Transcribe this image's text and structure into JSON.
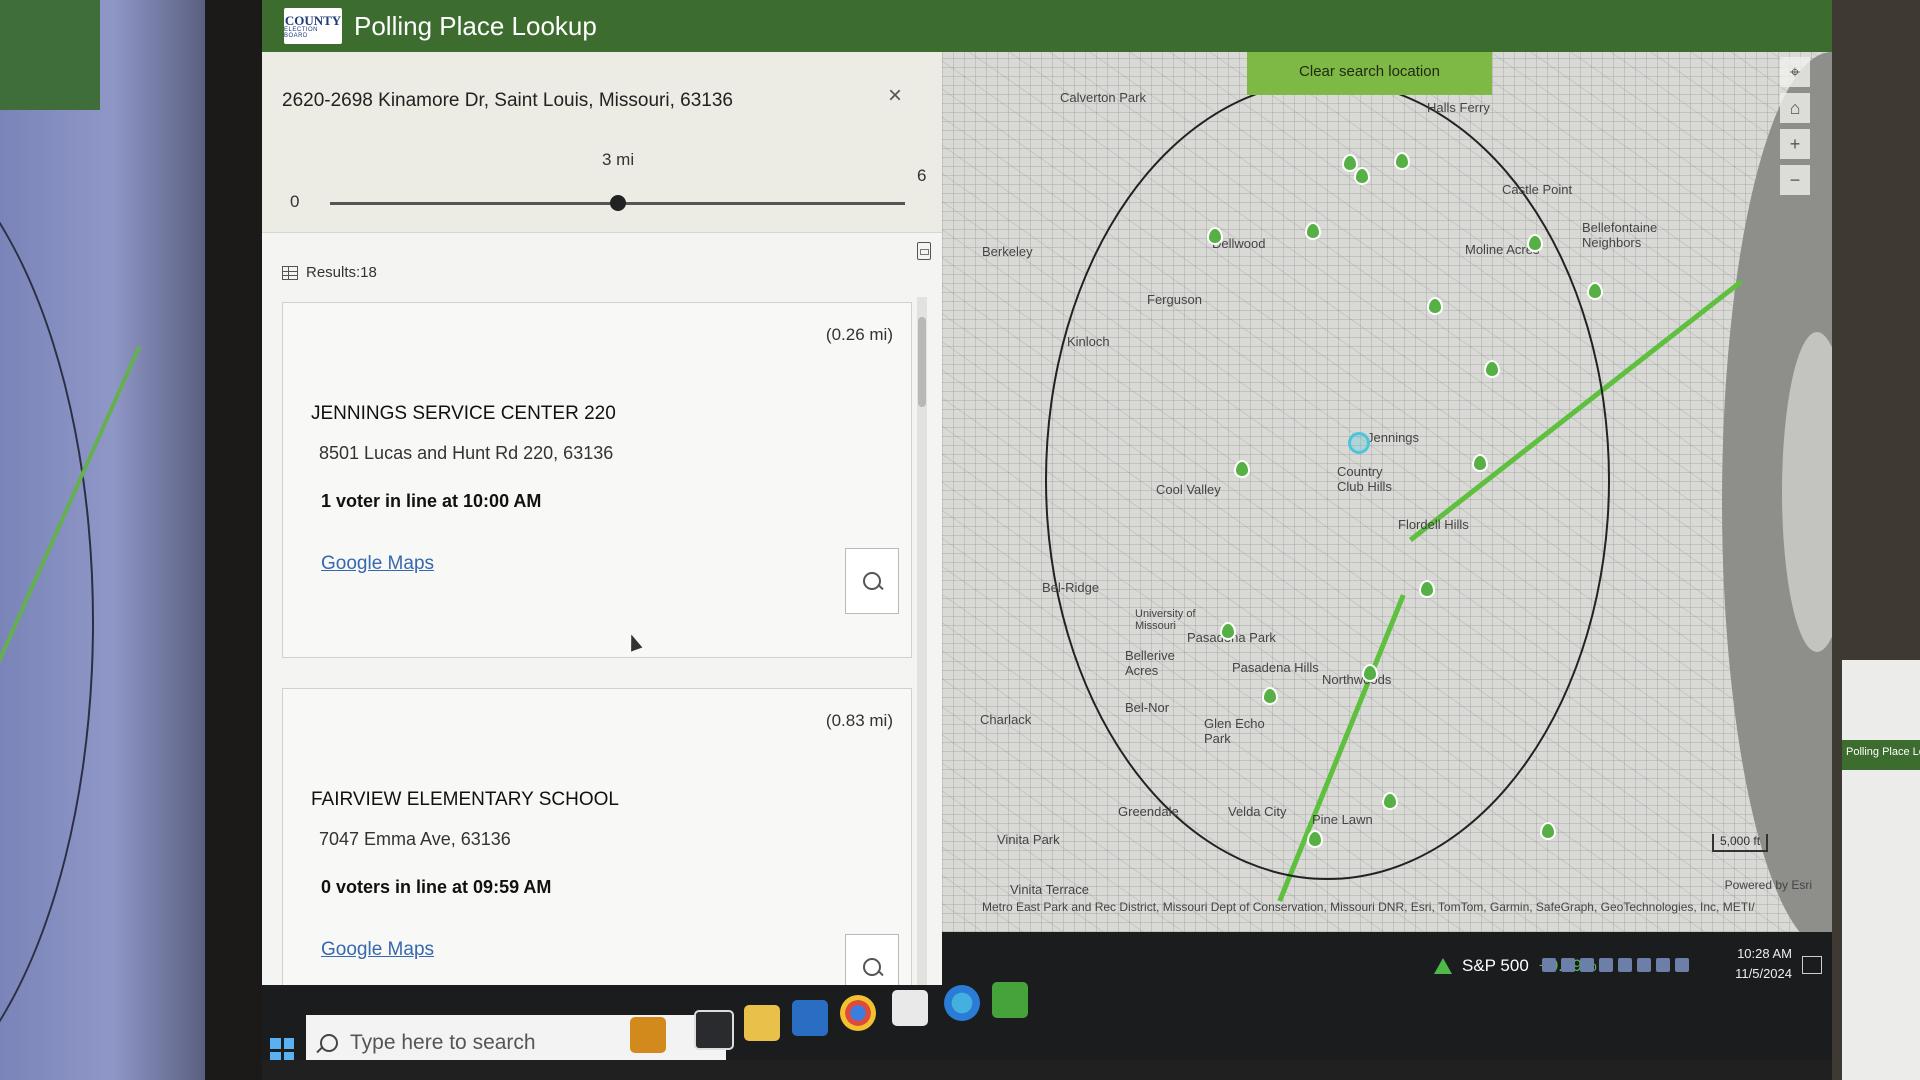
{
  "app": {
    "logo_top": "COUNTY",
    "logo_bottom": "ELECTION BOARD",
    "title": "Polling Place Lookup"
  },
  "search": {
    "address": "2620-2698 Kinamore Dr, Saint Louis, Missouri, 63136",
    "close_icon": "×",
    "distance_label": "3 mi",
    "range_min": "0",
    "range_max": "6",
    "slider_value": 3,
    "slider_max": 6
  },
  "results": {
    "count_label": "Results:18",
    "items": [
      {
        "distance": "(0.26 mi)",
        "name": "JENNINGS SERVICE CENTER 220",
        "address": "8501 Lucas and Hunt Rd 220, 63136",
        "line_status": "1 voter in line at 10:00 AM",
        "link": "Google Maps"
      },
      {
        "distance": "(0.83 mi)",
        "name": "FAIRVIEW ELEMENTARY SCHOOL",
        "address": "7047 Emma Ave, 63136",
        "line_status": "0 voters in line at 09:59 AM",
        "link": "Google Maps"
      }
    ]
  },
  "map": {
    "clear_button": "Clear search location",
    "tools": [
      "⌖",
      "⌂",
      "+",
      "−"
    ],
    "places": {
      "calverton_park": "Calverton Park",
      "halls_ferry": "Halls Ferry",
      "castle_point": "Castle Point",
      "bellefontaine": "Bellefontaine Neighbors",
      "berkeley": "Berkeley",
      "dellwood": "Dellwood",
      "ferguson": "Ferguson",
      "moline_acres": "Moline Acres",
      "kinloch": "Kinloch",
      "jennings": "Jennings",
      "country_club_hills": "Country Club Hills",
      "flordell_hills": "Flordell Hills",
      "cool_valley": "Cool Valley",
      "bel_ridge": "Bel-Ridge",
      "university": "University of Missouri",
      "bellerive_acres": "Bellerive Acres",
      "pasadena_park": "Pasadena Park",
      "pasadena_hills": "Pasadena Hills",
      "northwoods": "Northwoods",
      "bel_nor": "Bel-Nor",
      "glen_echo_park": "Glen Echo Park",
      "charlack": "Charlack",
      "greendale": "Greendale",
      "velda_city": "Velda City",
      "pine_lawn": "Pine Lawn",
      "vinita_park": "Vinita Park",
      "vinita_terrace": "Vinita Terrace"
    },
    "scale": "5,000 ft",
    "powered_by": "Powered by Esri",
    "attribution": "Metro East Park and Rec District, Missouri Dept of Conservation, Missouri DNR, Esri, TomTom, Garmin, SafeGraph, GeoTechnologies, Inc, METI/"
  },
  "taskbar": {
    "search_placeholder": "Type here to search",
    "stock_name": "S&P 500",
    "stock_change": "+0.89%",
    "time": "10:28 AM",
    "date": "11/5/2024"
  },
  "colors": {
    "header": "#3c6c2e",
    "accent": "#7eb845",
    "pin": "#56b045",
    "link": "#3668b0"
  }
}
